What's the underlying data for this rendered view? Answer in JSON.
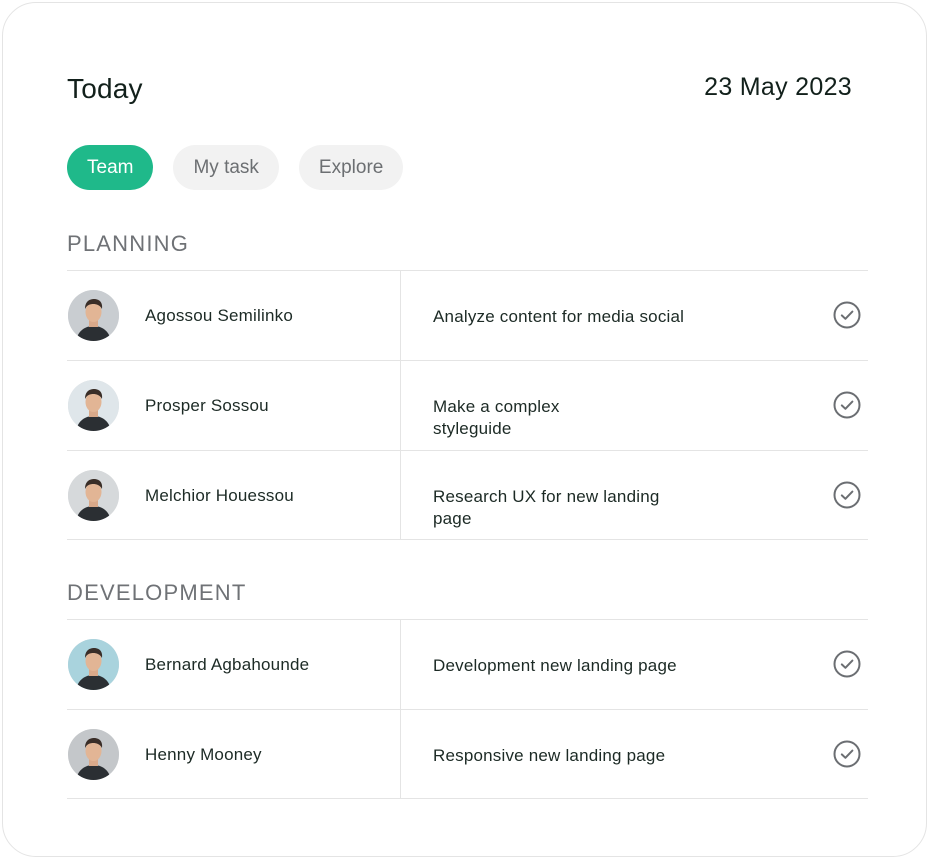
{
  "header": {
    "title": "Today",
    "date": "23 May 2023"
  },
  "tabs": [
    {
      "label": "Team",
      "active": true
    },
    {
      "label": "My task",
      "active": false
    },
    {
      "label": "Explore",
      "active": false
    }
  ],
  "sections": {
    "planning": {
      "label": "PLANNING",
      "rows": [
        {
          "name": "Agossou Semilinko",
          "task": "Analyze content for media social",
          "avatar_bg": "#c9cdd1"
        },
        {
          "name": "Prosper Sossou",
          "task": "Make a complex\nstyleguide",
          "avatar_bg": "#dfe6ea"
        },
        {
          "name": "Melchior Houessou",
          "task": "Research UX for new landing page",
          "avatar_bg": "#d6d9db"
        }
      ]
    },
    "development": {
      "label": "DEVELOPMENT",
      "rows": [
        {
          "name": "Bernard Agbahounde",
          "task": "Development new landing page",
          "avatar_bg": "#a9d3dd"
        },
        {
          "name": "Henny Mooney",
          "task": "Responsive new landing page",
          "avatar_bg": "#c4c7ca"
        }
      ]
    }
  },
  "icons": {
    "check": "check-circle-icon",
    "avatar": "avatar-photo"
  },
  "colors": {
    "accent": "#1fb98a",
    "tab_inactive_bg": "#f2f2f2",
    "divider": "#e4e4e4",
    "section_label": "#6f7276"
  }
}
